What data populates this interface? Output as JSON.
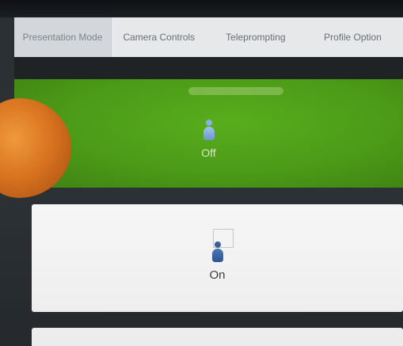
{
  "tabs": [
    {
      "label": "Presentation Mode",
      "active": true
    },
    {
      "label": "Camera Controls",
      "active": false
    },
    {
      "label": "Teleprompting",
      "active": false
    },
    {
      "label": "Profile Option",
      "active": false
    }
  ],
  "modes": {
    "off": {
      "label": "Off",
      "icon": "person-icon",
      "color": "#4c9a18",
      "selected": true
    },
    "on": {
      "label": "On",
      "icon": "person-icon",
      "color": "#eeeeee",
      "selected": false
    }
  }
}
